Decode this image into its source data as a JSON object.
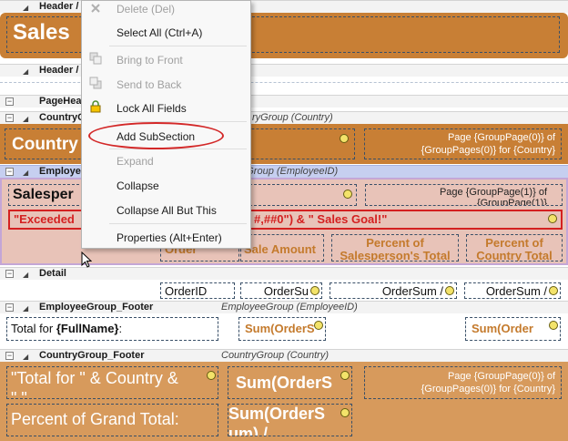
{
  "report": {
    "header_band": {
      "name": "Header /",
      "title": "Sales"
    },
    "header_footer_band": {
      "name": "Header /"
    },
    "page_header_band": {
      "name": "PageHead"
    },
    "country_group_band": {
      "name": "CountryG",
      "desc": "ryGroup (Country)",
      "country_field": "Country",
      "page_text_line1": "Page {GroupPage(0)} of",
      "page_text_line2": "{GroupPages(0)} for {Country}"
    },
    "employee_group_band": {
      "name": "Employe",
      "desc": "eeGroup (EmployeeID)",
      "salesperson_field": "Salesper",
      "page_text_line1": "Page {GroupPage(1)} of",
      "page_text_line2": "{GroupPage(1)}",
      "exceeded_text": "\"Exceeded",
      "exceeded_tail": "#,##0\") & \" Sales Goal!\"",
      "col_order": "Order",
      "col_sale_amount": "Sale Amount",
      "col_pct_salesperson_l1": "Percent of",
      "col_pct_salesperson_l2": "Salesperson's Total",
      "col_pct_country_l1": "Percent of",
      "col_pct_country_l2": "Country Total"
    },
    "detail_band": {
      "name": "Detail",
      "order_id": "OrderID",
      "order_sum": "OrderSu",
      "order_sum_pct1": "OrderSum /",
      "order_sum_pct2": "OrderSum /"
    },
    "employee_footer_band": {
      "name": "EmployeeGroup_Footer",
      "desc": "EmployeeGroup (EmployeeID)",
      "total_prefix": "Total for ",
      "total_bold": "{FullName}",
      "total_suffix": ":",
      "sum1": "Sum(OrderS",
      "sum2": "Sum(Order"
    },
    "country_footer_band": {
      "name": "CountryGroup_Footer",
      "desc": "CountryGroup (Country)",
      "total_line1": "\"Total for \" & Country &",
      "total_line2": "\" \"",
      "sum_orders": "Sum(OrderS",
      "page_text_line1": "Page {GroupPage(0)} of",
      "page_text_line2": "{GroupPages(0)} for {Country}",
      "pct_grand": "Percent of Grand Total:",
      "sum_orders2_l1": "Sum(OrderS",
      "sum_orders2_l2": "um) /"
    }
  },
  "context_menu": {
    "delete": "Delete (Del)",
    "select_all": "Select All (Ctrl+A)",
    "bring_front": "Bring to Front",
    "send_back": "Send to Back",
    "lock_fields": "Lock All Fields",
    "add_subsection": "Add SubSection",
    "expand": "Expand",
    "collapse": "Collapse",
    "collapse_all_but": "Collapse All But This",
    "properties": "Properties (Alt+Enter)"
  },
  "colors": {
    "band_brown": "#c87f35",
    "band_tan": "#d79a5c",
    "highlight_red": "#d32828",
    "selected_band": "#c6cff0"
  }
}
